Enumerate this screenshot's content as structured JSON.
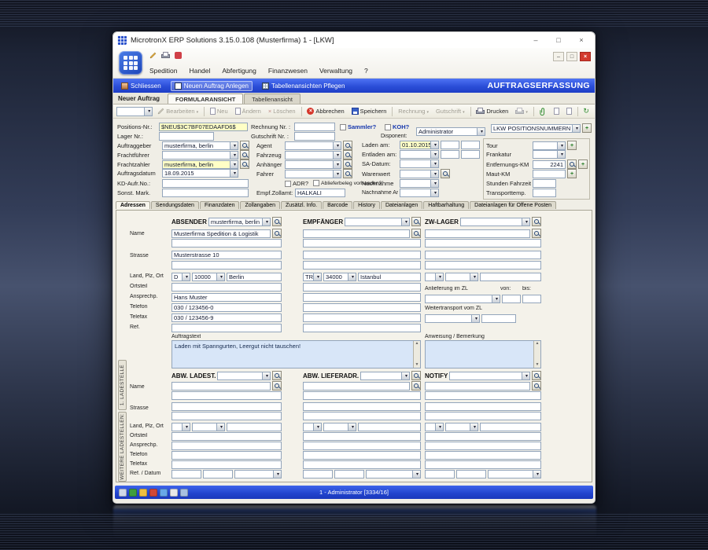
{
  "window": {
    "title": "MicrotronX ERP Solutions 3.15.0.108 (Musterfirma) 1 - [LKW]"
  },
  "icons": {
    "minimize": "–",
    "maximize": "□",
    "close": "×",
    "refresh": "↻",
    "cancel_x": "×"
  },
  "menu": {
    "items": [
      "Spedition",
      "Handel",
      "Abfertigung",
      "Finanzwesen",
      "Verwaltung",
      "?"
    ]
  },
  "cmdbar": {
    "close": "Schliessen",
    "new_order": "Neuen Auftrag Anlegen",
    "manage_views": "Tabellenansichten Pflegen",
    "title": "AUFTRAGSERFASSUNG"
  },
  "viewtabs": {
    "caption": "Neuer Auftrag",
    "tabs": [
      "FORMULARANSICHT",
      "Tabellenansicht"
    ]
  },
  "toolbar": {
    "edit": "Bearbeiten",
    "new": "Neu",
    "change": "Ändern",
    "delete": "Löschen",
    "cancel": "Abbrechen",
    "save": "Speichern",
    "invoice": "Rechnung",
    "credit": "Gutschrift",
    "print": "Drucken"
  },
  "head": {
    "pos_label": "Positions-Nr.:",
    "pos_value": "$NEU$3C7BF07EDAAFD6$",
    "lager_label": "Lager Nr.:",
    "invoice_label": "Rechnung Nr. :",
    "credit_label": "Gutschrift Nr. :",
    "sammler_label": "Sammler?",
    "koh_label": "KOH?",
    "disponent_label": "Disponent:",
    "disponent_value": "Administrator",
    "posnumbers_value": "LKW POSITIONSNUMMERN"
  },
  "order": {
    "auftraggeber_label": "Auftraggeber",
    "auftraggeber_value": "musterfirma, berlin",
    "frachtfuehrer_label": "Frachtführer",
    "frachtzahler_label": "Frachtzahler",
    "frachtzahler_value": "musterfirma, berlin",
    "auftragsdatum_label": "Auftragsdatum",
    "auftragsdatum_value": "18.09.2015",
    "kd_auftr_label": "KD-Aufr.No.:",
    "sonst_label": "Sonst. Mark.",
    "agent_label": "Agent",
    "fahrzeug_label": "Fahrzeug",
    "anhaenger_label": "Anhänger",
    "fahrer_label": "Fahrer",
    "adr_label": "ADR?",
    "ablieferbeleg_label": "Ablieferbeleg vorhanden?",
    "zollamt_label": "Empf.Zollamt:",
    "zollamt_value": "HALKALI",
    "laden_label": "Laden am:",
    "laden_value": "01.10.2015",
    "entladen_label": "Entladen am:",
    "sa_datum_label": "SA-Datum:",
    "warenwert_label": "Warenwert",
    "nachnahme_label": "Nachnahme",
    "nachnahme_art_label": "Nachnahme Art",
    "tour_label": "Tour",
    "frankatur_label": "Frankatur",
    "entfernung_label": "Entfernungs-KM",
    "entfernung_value": "2241",
    "maut_label": "Maut-KM",
    "stunden_label": "Stunden Fahrzeit",
    "temp_label": "Transporttemp."
  },
  "maintabs": {
    "items": [
      "Adressen",
      "Sendungsdaten",
      "Finanzdaten",
      "Zollangaben",
      "Zusätzl. Info.",
      "Barcode",
      "History",
      "Dateianlagen",
      "Haftbarhaltung",
      "Dateianlagen für Offene Posten"
    ]
  },
  "addr": {
    "row_labels": [
      "Name",
      "Strasse",
      "Land, Plz, Ort",
      "Ortsteil",
      "Ansprechp.",
      "Telefon",
      "Telefax",
      "Ref."
    ],
    "absender": {
      "title": "ABSENDER",
      "selector": "musterfirma, berlin",
      "name1": "Musterfirma Spedition & Logistik",
      "strasse": "Musterstrasse 10",
      "land": "D",
      "plz": "10000",
      "ort": "Berlin",
      "ansprechpartner": "Hans Muster",
      "telefon": "030 / 123456-0",
      "telefax": "030 / 123456-9"
    },
    "empfaenger": {
      "title": "EMPFÄNGER",
      "land": "TR",
      "plz": "34000",
      "ort": "Istanbul"
    },
    "zwlager": {
      "title": "ZW-LAGER",
      "anlieferung_label": "Anlieferung im ZL",
      "von_label": "von:",
      "bis_label": "bis:",
      "weitertransport_label": "Weitertransport vom ZL"
    },
    "auftragstext_label": "Auftragstext",
    "auftragstext_value": "Laden mit Spanngurten, Leergut nicht tauschen!",
    "anweisung_label": "Anweisung / Bemerkung"
  },
  "abw": {
    "row_labels": [
      "Name",
      "Strasse",
      "Land, Plz, Ort",
      "Ortsteil",
      "Ansprechp.",
      "Telefon",
      "Telefax",
      "Ref. / Datum"
    ],
    "ladest_title": "ABW. LADEST.",
    "lieferadr_title": "ABW. LIEFERADR.",
    "notify_title": "NOTIFY"
  },
  "side": {
    "tab1": "1. LADESTELLE",
    "tab2": "WEITERE LADESTELLEN:"
  },
  "status": {
    "text": "1 - Administrator [3334/16]"
  }
}
